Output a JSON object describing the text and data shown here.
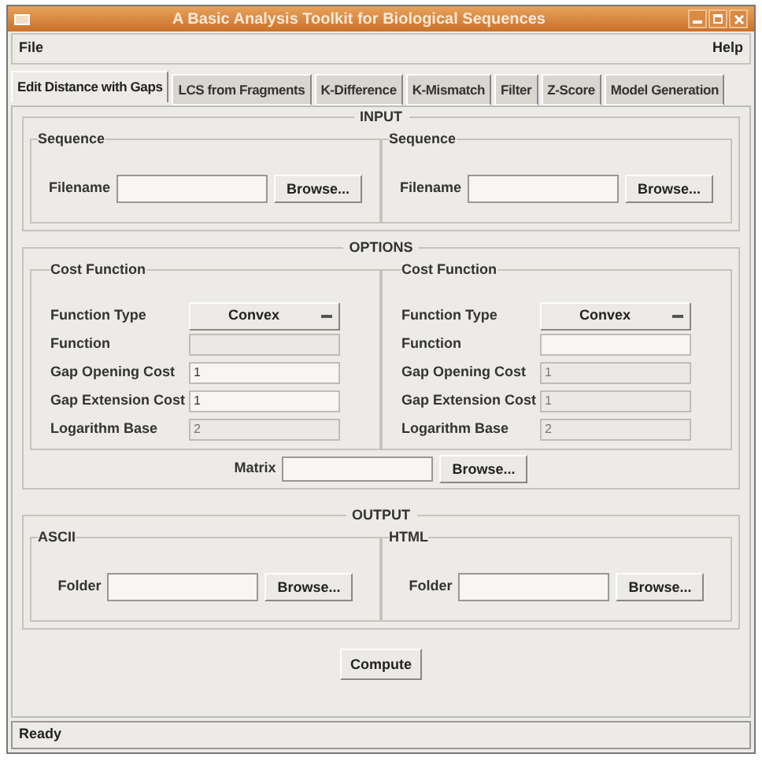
{
  "window": {
    "title": "A Basic Analysis Toolkit for Biological Sequences"
  },
  "menu": [
    "File",
    "Help"
  ],
  "tabs": [
    {
      "label": "Edit Distance with Gaps",
      "selected": true
    },
    {
      "label": "LCS from Fragments",
      "selected": false
    },
    {
      "label": "K-Difference",
      "selected": false
    },
    {
      "label": "K-Mismatch",
      "selected": false
    },
    {
      "label": "Filter",
      "selected": false
    },
    {
      "label": "Z-Score",
      "selected": false
    },
    {
      "label": "Model Generation",
      "selected": false
    }
  ],
  "input": {
    "title": "INPUT",
    "panels": [
      {
        "title": "Sequence",
        "label": "Filename",
        "button": "Browse..."
      },
      {
        "title": "Sequence",
        "label": "Filename",
        "button": "Browse..."
      }
    ]
  },
  "options": {
    "title": "OPTIONS",
    "panels": [
      {
        "title": "Cost Function",
        "rows": [
          {
            "kind": "dropdown",
            "label": "Function Type",
            "value": "Convex"
          },
          {
            "kind": "field",
            "label": "Function",
            "disabled": true
          },
          {
            "kind": "field",
            "label": "Gap Opening Cost",
            "value": "1",
            "disabled": false
          },
          {
            "kind": "field",
            "label": "Gap Extension Cost",
            "value": "1",
            "disabled": false
          },
          {
            "kind": "field",
            "label": "Logarithm Base",
            "value": "2",
            "disabled": true
          }
        ]
      },
      {
        "title": "Cost Function",
        "rows": [
          {
            "kind": "dropdown",
            "label": "Function Type",
            "value": "Convex"
          },
          {
            "kind": "field",
            "label": "Function",
            "disabled": false
          },
          {
            "kind": "field",
            "label": "Gap Opening Cost",
            "value": "1",
            "disabled": true
          },
          {
            "kind": "field",
            "label": "Gap Extension Cost",
            "value": "1",
            "disabled": true
          },
          {
            "kind": "field",
            "label": "Logarithm Base",
            "value": "2",
            "disabled": true
          }
        ]
      }
    ],
    "matrix": {
      "label": "Matrix",
      "button": "Browse..."
    }
  },
  "output": {
    "title": "OUTPUT",
    "panels": [
      {
        "title": "ASCII",
        "label": "Folder",
        "button": "Browse..."
      },
      {
        "title": "HTML",
        "label": "Folder",
        "button": "Browse..."
      }
    ]
  },
  "compute": "Compute",
  "status": "Ready"
}
